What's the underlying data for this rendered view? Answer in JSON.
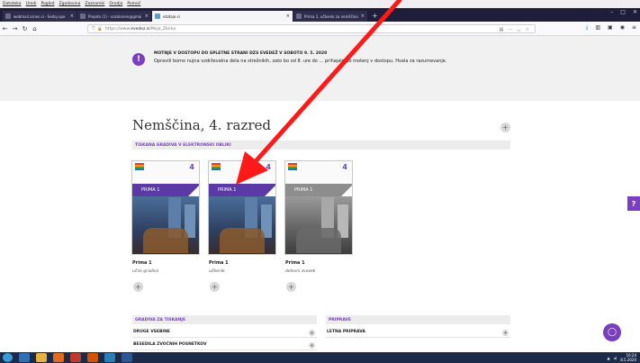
{
  "menubar": [
    "Datoteka",
    "Uredi",
    "Pogled",
    "Zgodovina",
    "Zaznamki",
    "Orodja",
    "Pomoč"
  ],
  "tabs": [
    {
      "label": "webmail.arnes.si - Sedaj ope",
      "active": false
    },
    {
      "label": "Prejeto (1) - vozolonen@gmai",
      "active": false
    },
    {
      "label": "eIzdaje.si",
      "active": true
    },
    {
      "label": "Prima 1, učbenik za nemščino kot",
      "active": false
    }
  ],
  "url": {
    "prefix": "https://www.",
    "host": "evedez.si",
    "path": "/Moja_Zbirka"
  },
  "notice": {
    "icon": "!",
    "title": "MOTNJE V DOSTOPU DO SPLETNE STRANI DZS EVEDEŽ V SOBOTO 9. 5. 2020",
    "text": "Opravili bomo nujna vzdrževalna dela na strežnikih, zato bo od 8. ure do … prihajalo do motenj v dostopu. Hvala za razumevanje."
  },
  "page_title": "Nemščina, 4. razred",
  "section_printed": "TISKANA GRADIVA V ELEKTRONSKI OBLIKI",
  "books": [
    {
      "name": "Prima 1",
      "type": "učno gradivo",
      "cover_title": "PRIMA 1",
      "number": "4",
      "bw": false
    },
    {
      "name": "Prima 1",
      "type": "učbenik",
      "cover_title": "PRIMA 1",
      "number": "4",
      "bw": false
    },
    {
      "name": "Prima 1",
      "type": "delovni zvezek",
      "cover_title": "PRIMA 1",
      "number": "4",
      "bw": true
    }
  ],
  "plus_glyph": "+",
  "print_section": {
    "title": "GRADIVA ZA TISKANJE",
    "items": [
      "DRUGE VSEBINE",
      "BESEDILA ZVOČNIH POSNETKOV"
    ]
  },
  "prep_section": {
    "title": "PRIPRAVE",
    "items": [
      "LETNA PRIPRAVA"
    ]
  },
  "help_label": "?",
  "clock": {
    "time": "10:24",
    "date": "8.5.2020"
  },
  "colors": {
    "accent": "#7a3fbf",
    "annotation": "#ff1a1a",
    "taskbar": "#1c2b4a"
  }
}
